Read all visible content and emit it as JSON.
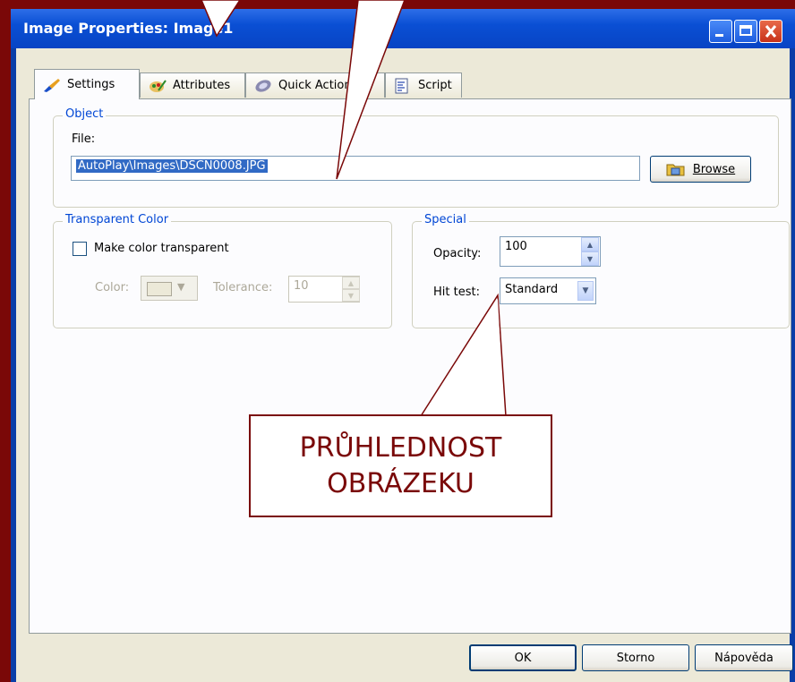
{
  "window": {
    "title": "Image Properties: Image1"
  },
  "tabs": [
    {
      "label": "Settings"
    },
    {
      "label": "Attributes"
    },
    {
      "label": "Quick Action"
    },
    {
      "label": "Script"
    }
  ],
  "object_group": {
    "title": "Object",
    "file_label": "File:",
    "file_value": "AutoPlay\\Images\\DSCN0008.JPG",
    "browse_label": "Browse"
  },
  "transparent_group": {
    "title": "Transparent Color",
    "make_transparent_label": "Make color transparent",
    "color_label": "Color:",
    "tolerance_label": "Tolerance:",
    "tolerance_value": "10"
  },
  "special_group": {
    "title": "Special",
    "opacity_label": "Opacity:",
    "opacity_value": "100",
    "hit_test_label": "Hit test:",
    "hit_test_value": "Standard"
  },
  "buttons": {
    "ok": "OK",
    "cancel": "Storno",
    "help": "Nápověda"
  },
  "callout": {
    "line1": "PRŮHLEDNOST",
    "line2": "OBRÁZEKU"
  },
  "colors": {
    "background": "#7a0808",
    "accent": "#0046d5"
  }
}
